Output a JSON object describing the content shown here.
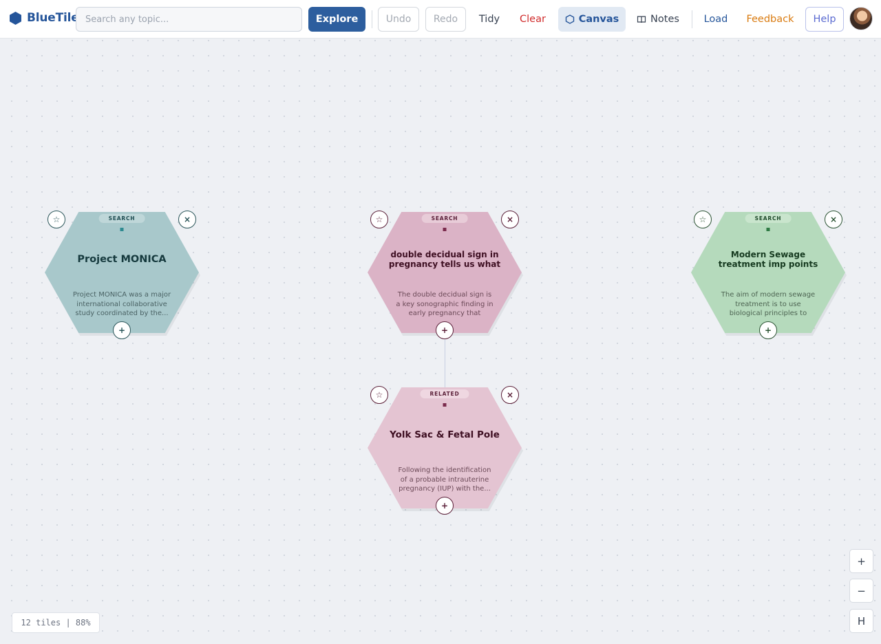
{
  "app": {
    "name": "BlueTile"
  },
  "toolbar": {
    "search_placeholder": "Search any topic...",
    "search_value": "",
    "explore": "Explore",
    "undo": "Undo",
    "redo": "Redo",
    "tidy": "Tidy",
    "clear": "Clear",
    "canvas": "Canvas",
    "notes": "Notes",
    "load": "Load",
    "feedback": "Feedback",
    "help": "Help"
  },
  "tiles": [
    {
      "tag": "SEARCH",
      "title": "Project MONICA",
      "summary": "Project MONICA was a major international collaborative study coordinated by the...",
      "color": "#a8c8cb"
    },
    {
      "tag": "SEARCH",
      "title": "double decidual sign in pregnancy tells us what",
      "summary": "The double decidual sign is a key sonographic finding in early pregnancy that strongl...",
      "color": "#dbb3c6"
    },
    {
      "tag": "SEARCH",
      "title": "Modern Sewage treatment imp points",
      "summary": "The aim of modern sewage treatment is to use biological principles to \"stabilize\" the...",
      "color": "#b5dabc"
    },
    {
      "tag": "RELATED",
      "title": "Yolk Sac & Fetal Pole",
      "summary": "Following the identification of a probable intrauterine pregnancy (IUP) with the...",
      "color": "#e4c4d2"
    }
  ],
  "tile_controls": {
    "favorite": "☆",
    "remove": "×",
    "expand": "+"
  },
  "zoom": {
    "in": "+",
    "out": "−",
    "home": "H"
  },
  "status": "12 tiles | 88%"
}
